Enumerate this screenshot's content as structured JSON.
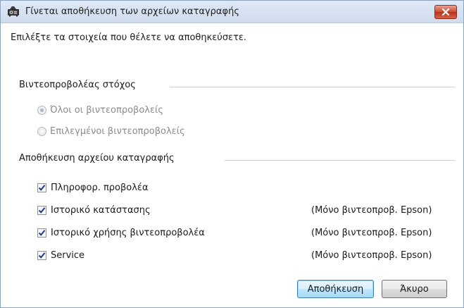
{
  "window": {
    "title": "Γίνεται αποθήκευση των αρχείων καταγραφής"
  },
  "instructions": "Επιλέξτε τα στοιχεία που θέλετε να αποθηκεύσετε.",
  "target_group": {
    "header": "Βιντεοπροβολέας στόχος",
    "options": [
      {
        "label": "Όλοι οι βιντεοπροβολείς",
        "selected": true
      },
      {
        "label": "Επιλεγμένοι βιντεοπροβολείς",
        "selected": false
      }
    ]
  },
  "log_group": {
    "header": "Αποθήκευση αρχείου καταγραφής",
    "items": [
      {
        "label": "Πληροφορ. προβολέα",
        "checked": true,
        "note": ""
      },
      {
        "label": "Ιστορικό κατάστασης",
        "checked": true,
        "note": "(Μόνο βιντεοπροβ. Epson)"
      },
      {
        "label": "Ιστορικό χρήσης βιντεοπροβολέα",
        "checked": true,
        "note": "(Μόνο βιντεοπροβ. Epson)"
      },
      {
        "label": "Service",
        "checked": true,
        "note": "(Μόνο βιντεοπροβ. Epson)"
      }
    ]
  },
  "buttons": {
    "save": "Αποθήκευση",
    "cancel": "Άκυρο"
  },
  "colors": {
    "titlebar": "#dfe9f6",
    "close_button": "#cc4a35",
    "check_mark": "#1f3f8f",
    "disabled_text": "#8a8a8a"
  },
  "icons": {
    "app": "projector-icon",
    "close": "close-icon",
    "check": "checkmark-icon"
  }
}
